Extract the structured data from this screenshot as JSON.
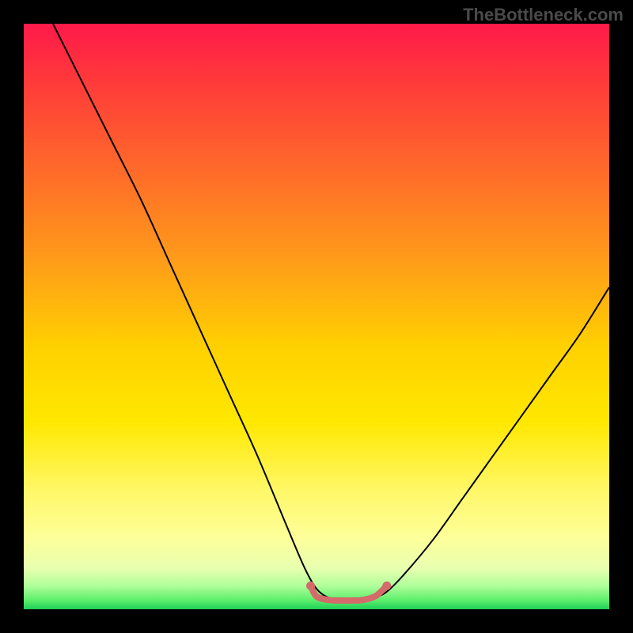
{
  "watermark": "TheBottleneck.com",
  "chart_data": {
    "type": "line",
    "title": "",
    "xlabel": "",
    "ylabel": "",
    "xlim": [
      0,
      100
    ],
    "ylim": [
      0,
      100
    ],
    "series": [
      {
        "name": "bottleneck-curve",
        "color": "#000000",
        "x": [
          5,
          10,
          15,
          20,
          25,
          30,
          35,
          40,
          45,
          48,
          50,
          52,
          54,
          56,
          58,
          60,
          62,
          65,
          70,
          75,
          80,
          85,
          90,
          95,
          100
        ],
        "y": [
          100,
          90,
          80,
          70,
          59,
          48,
          37,
          26,
          14,
          7,
          3.5,
          2,
          1.5,
          1.5,
          1.5,
          2,
          3,
          6,
          12,
          19,
          26,
          33,
          40,
          47,
          55
        ]
      },
      {
        "name": "optimal-range-marker",
        "color": "#d46a6a",
        "x": [
          49,
          50,
          52,
          54,
          56,
          58,
          60,
          61,
          62
        ],
        "y": [
          4,
          2.2,
          1.6,
          1.5,
          1.5,
          1.6,
          2.2,
          3,
          4
        ]
      }
    ],
    "gradient_stops": [
      {
        "pos": 0,
        "color": "#ff1a4a"
      },
      {
        "pos": 0.1,
        "color": "#ff3a3a"
      },
      {
        "pos": 0.25,
        "color": "#ff6a2a"
      },
      {
        "pos": 0.4,
        "color": "#ff9a1a"
      },
      {
        "pos": 0.55,
        "color": "#ffd000"
      },
      {
        "pos": 0.68,
        "color": "#ffe800"
      },
      {
        "pos": 0.8,
        "color": "#fff86a"
      },
      {
        "pos": 0.88,
        "color": "#fdff9a"
      },
      {
        "pos": 0.93,
        "color": "#e8ffb0"
      },
      {
        "pos": 0.96,
        "color": "#b0ff9a"
      },
      {
        "pos": 0.985,
        "color": "#5aee6a"
      },
      {
        "pos": 1.0,
        "color": "#1ecf5a"
      }
    ]
  }
}
